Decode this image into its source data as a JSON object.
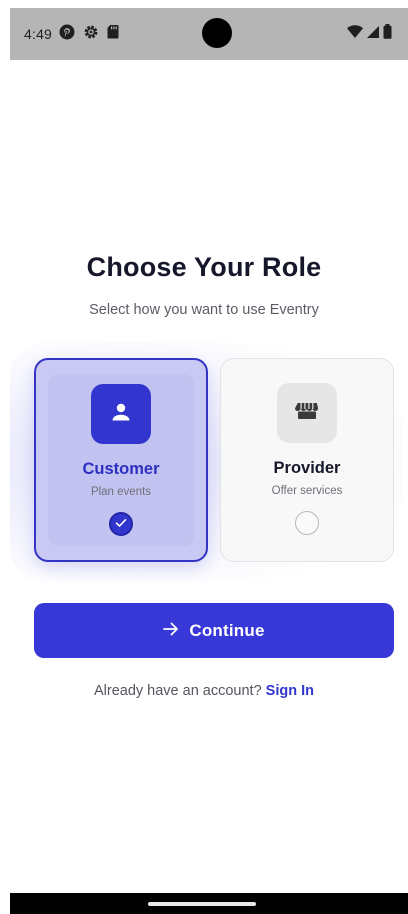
{
  "status_bar": {
    "time": "4:49",
    "left_icons": [
      "pinterest-icon",
      "settings-icon",
      "sd-card-icon"
    ],
    "right_icons": [
      "wifi-icon",
      "signal-icon",
      "battery-icon"
    ]
  },
  "header": {
    "title": "Choose Your Role",
    "subtitle": "Select how you want to use Eventry"
  },
  "roles": [
    {
      "title": "Customer",
      "description": "Plan events",
      "icon": "person-icon",
      "selected": true
    },
    {
      "title": "Provider",
      "description": "Offer services",
      "icon": "storefront-icon",
      "selected": false
    }
  ],
  "continue_button": {
    "label": "Continue",
    "icon": "arrow-right-icon"
  },
  "signin": {
    "prompt": "Already have an account?",
    "link": "Sign In"
  },
  "colors": {
    "primary": "#3837d8",
    "selected_card": "#c9c9f4",
    "title_text": "#16172b",
    "status_bar": "#b5b5b5"
  }
}
